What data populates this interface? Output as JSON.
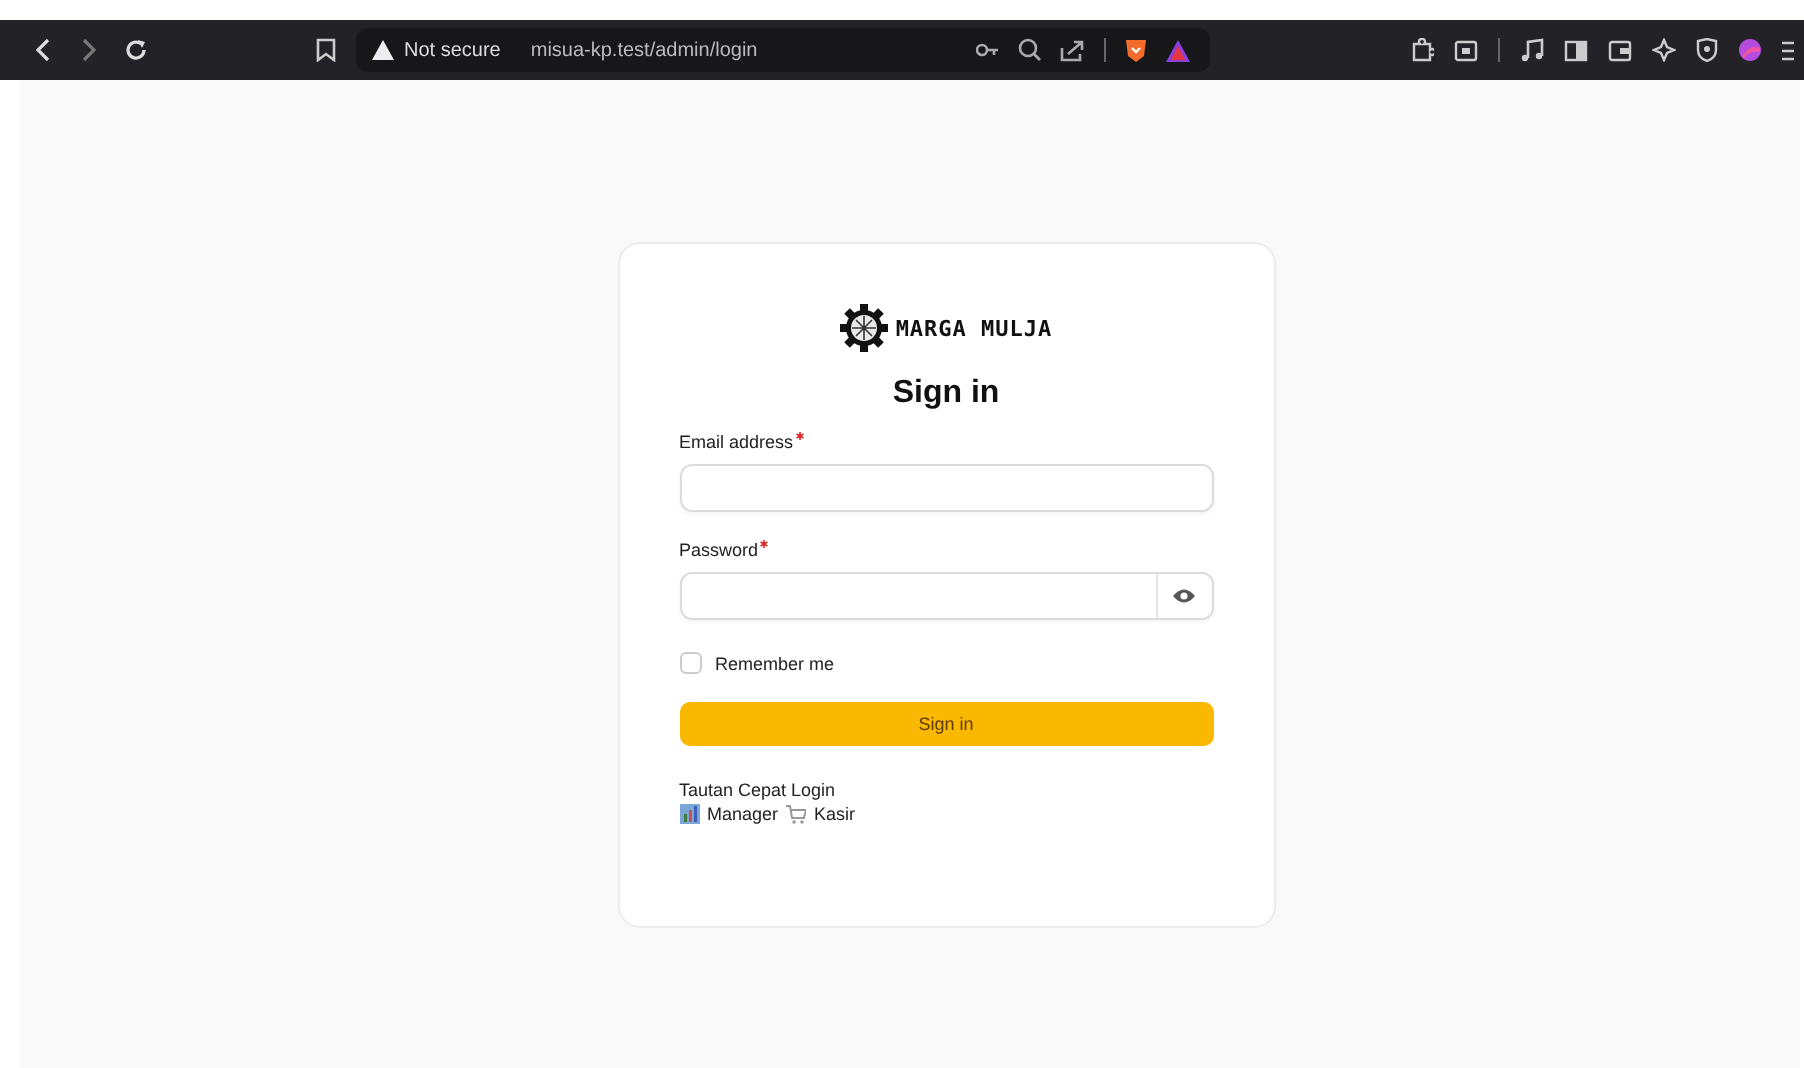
{
  "browser": {
    "security": "Not secure",
    "url": "misua-kp.test/admin/login"
  },
  "login": {
    "logo_text": "MARGA MULJA",
    "title": "Sign in",
    "fields": [
      {
        "label": "Email address",
        "required": true,
        "kind": "text"
      },
      {
        "label": "Password",
        "required": true,
        "kind": "password"
      }
    ],
    "remember": {
      "label": "Remember me",
      "checked": false
    },
    "submit": "Sign in",
    "quick_links": {
      "title": "Tautan Cepat Login",
      "links": [
        {
          "label": "Manager",
          "kind": "chart"
        },
        {
          "label": "Kasir",
          "kind": "cart"
        }
      ]
    }
  }
}
